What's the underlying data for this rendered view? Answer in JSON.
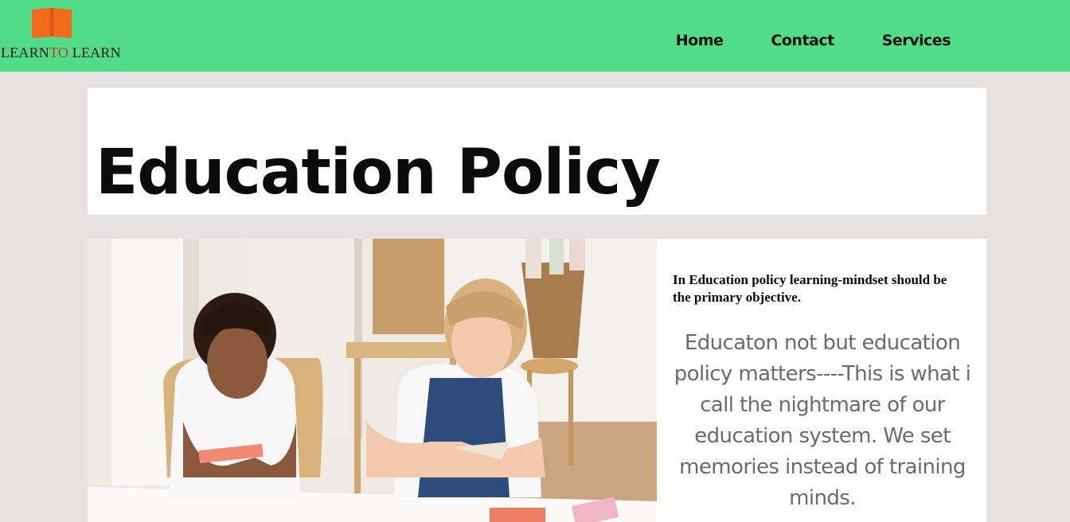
{
  "brand": {
    "logo_text_part1": "LEARN",
    "logo_text_part2": "TO",
    "logo_text_part3": " LEARN",
    "logo_color": "#f26b1d"
  },
  "nav": {
    "items": [
      {
        "label": "Home"
      },
      {
        "label": "Contact"
      },
      {
        "label": "Services"
      }
    ],
    "background": "#52dc87"
  },
  "main": {
    "title": "Education Policy",
    "tagline": "In Education policy learning-mindset should be the primary objective.",
    "quote": "Educaton not but education policy matters----This is what i call the nightmare of our education system. We set memories instead of training minds."
  }
}
